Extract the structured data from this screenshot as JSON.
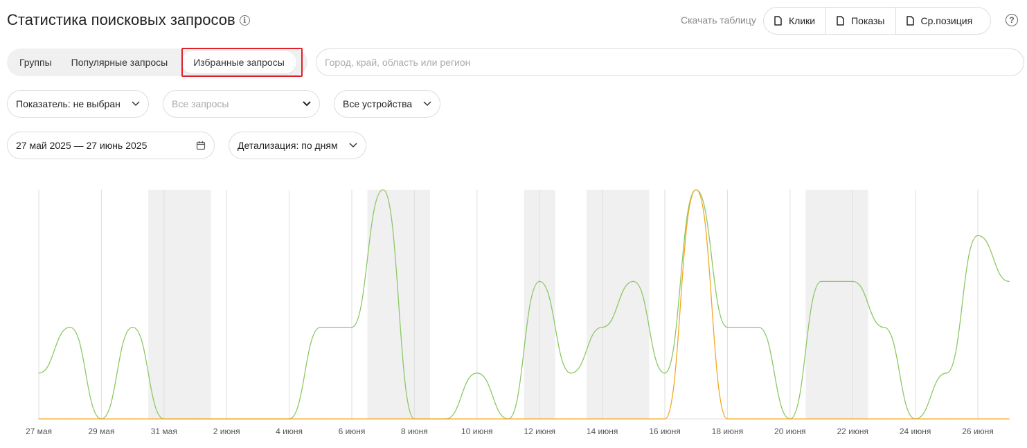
{
  "header": {
    "title": "Статистика поисковых запросов",
    "download_label": "Скачать таблицу",
    "download_buttons": [
      "Клики",
      "Показы",
      "Ср.позиция"
    ]
  },
  "tabs": [
    "Группы",
    "Популярные запросы",
    "Избранные запросы"
  ],
  "active_tab": "Избранные запросы",
  "region_search": {
    "placeholder": "Город, край, область или регион",
    "value": ""
  },
  "filters": {
    "metric": "Показатель: не выбран",
    "queries_placeholder": "Все запросы",
    "devices": "Все устройства",
    "date_range": "27 май 2025 — 27 июнь 2025",
    "detail": "Детализация: по дням"
  },
  "colors": {
    "green": "#8cc864",
    "orange": "#f5a623",
    "weekend": "#f0f0f0",
    "highlight": "#e0202a"
  },
  "chart_data": {
    "type": "line",
    "x": [
      "27 мая",
      "28 мая",
      "29 мая",
      "30 мая",
      "31 мая",
      "1 июня",
      "2 июня",
      "3 июня",
      "4 июня",
      "5 июня",
      "6 июня",
      "7 июня",
      "8 июня",
      "9 июня",
      "10 июня",
      "11 июня",
      "12 июня",
      "13 июня",
      "14 июня",
      "15 июня",
      "16 июня",
      "17 июня",
      "18 июня",
      "19 июня",
      "20 июня",
      "21 июня",
      "22 июня",
      "23 июня",
      "24 июня",
      "25 июня",
      "26 июня",
      "27 июня"
    ],
    "x_tick_labels": [
      "27 мая",
      "29 мая",
      "31 мая",
      "2 июня",
      "4 июня",
      "6 июня",
      "8 июня",
      "10 июня",
      "12 июня",
      "14 июня",
      "16 июня",
      "18 июня",
      "20 июня",
      "22 июня",
      "24 июня",
      "26 июня"
    ],
    "series": [
      {
        "color": "green",
        "values": [
          1,
          2,
          0,
          2,
          0,
          0,
          0,
          0,
          0,
          2,
          2,
          5,
          0,
          0,
          1,
          0,
          3,
          1,
          2,
          3,
          1,
          5,
          2,
          2,
          0,
          3,
          3,
          2,
          0,
          1,
          4,
          3
        ]
      },
      {
        "color": "orange",
        "values": [
          0,
          0,
          0,
          0,
          0,
          0,
          0,
          0,
          0,
          0,
          0,
          0,
          0,
          0,
          0,
          0,
          0,
          0,
          0,
          0,
          0,
          5,
          0,
          0,
          0,
          0,
          0,
          0,
          0,
          0,
          0,
          0
        ]
      }
    ],
    "weekend_bands": [
      [
        "31 мая",
        "1 июня"
      ],
      [
        "7 июня",
        "8 июня"
      ],
      [
        "12 июня",
        "12 июня"
      ],
      [
        "14 июня",
        "15 июня"
      ],
      [
        "21 июня",
        "22 июня"
      ]
    ],
    "ylim": [
      0,
      5
    ],
    "grid": true
  }
}
